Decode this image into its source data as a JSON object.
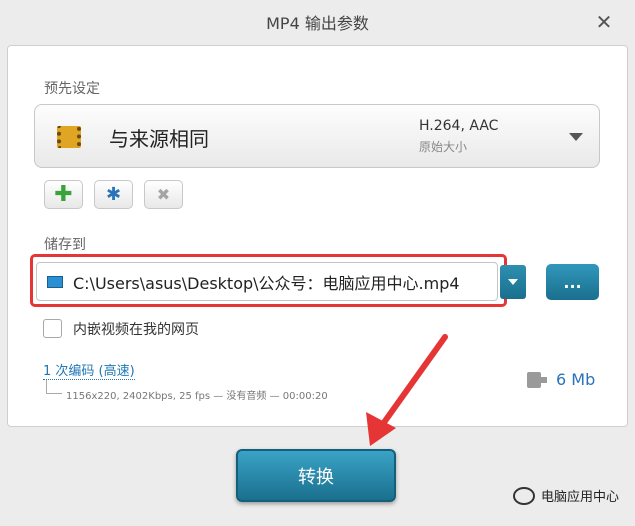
{
  "window": {
    "title": "MP4 输出参数",
    "close_glyph": "✕"
  },
  "preset": {
    "section_label": "预先设定",
    "name": "与来源相同",
    "codec": "H.264, AAC",
    "size_mode": "原始大小",
    "icon": "film-icon"
  },
  "toolbar": {
    "add_glyph": "✚",
    "settings_glyph": "✱",
    "delete_glyph": "✖"
  },
  "output": {
    "section_label": "储存到",
    "path": "C:\\Users\\asus\\Desktop\\公众号：电脑应用中心.mp4",
    "browse_label": "..."
  },
  "embed": {
    "label": "内嵌视频在我的网页",
    "checked": false
  },
  "encoding": {
    "link_label": "1 次编码 (高速)",
    "details": "1156x220, 2402Kbps, 25 fps — 没有音频 — 00:00:20",
    "estimated_size": "6 Mb"
  },
  "actions": {
    "convert_label": "转换"
  },
  "watermark": {
    "text": "电脑应用中心"
  },
  "colors": {
    "accent": "#1a6f8e",
    "highlight": "#e53535",
    "link": "#1f77b4"
  }
}
